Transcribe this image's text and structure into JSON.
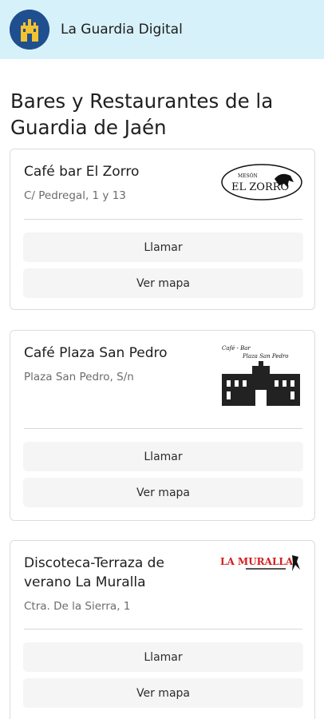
{
  "app": {
    "title": "La Guardia Digital",
    "logo_icon": "castle-shield-icon"
  },
  "page": {
    "title": "Bares y Restaurantes de la Guardia de Jaén"
  },
  "listings": [
    {
      "name": "Café bar El Zorro",
      "address": "C/ Pedregal, 1 y 13",
      "logo_text": [
        "MESÓN",
        "EL ZORRO"
      ],
      "call_label": "Llamar",
      "map_label": "Ver mapa"
    },
    {
      "name": "Café Plaza San Pedro",
      "address": "Plaza San Pedro, S/n",
      "logo_text": [
        "Café - Bar",
        "Plaza San Pedro"
      ],
      "call_label": "Llamar",
      "map_label": "Ver mapa"
    },
    {
      "name": "Discoteca-Terraza de verano La Muralla",
      "address": "Ctra. De la Sierra, 1",
      "logo_text": [
        "LA MURALLA"
      ],
      "call_label": "Llamar",
      "map_label": "Ver mapa"
    }
  ]
}
